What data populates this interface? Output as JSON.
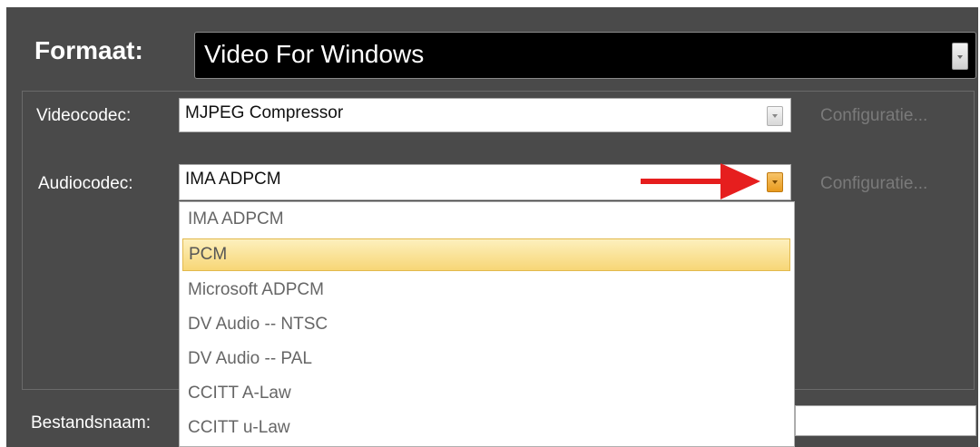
{
  "format": {
    "label": "Formaat:",
    "value": "Video For Windows"
  },
  "video": {
    "label": "Videocodec:",
    "value": "MJPEG Compressor",
    "config_label": "Configuratie..."
  },
  "audio": {
    "label": "Audiocodec:",
    "value": "IMA ADPCM",
    "config_label": "Configuratie...",
    "options": [
      "IMA ADPCM",
      "PCM",
      "Microsoft ADPCM",
      "DV Audio -- NTSC",
      "DV Audio -- PAL",
      "CCITT A-Law",
      "CCITT u-Law"
    ],
    "highlighted": "PCM"
  },
  "filename": {
    "label": "Bestandsnaam:",
    "value": ""
  },
  "colors": {
    "background": "#4a4a4a",
    "format_field": "#000000",
    "highlight": "#f7d676",
    "active_arrow": "#e89a1e",
    "annotation_arrow": "#e61e1e"
  },
  "icons": {
    "format_dropdown": "chevron-down-icon",
    "annotation": "red-arrow-icon"
  }
}
